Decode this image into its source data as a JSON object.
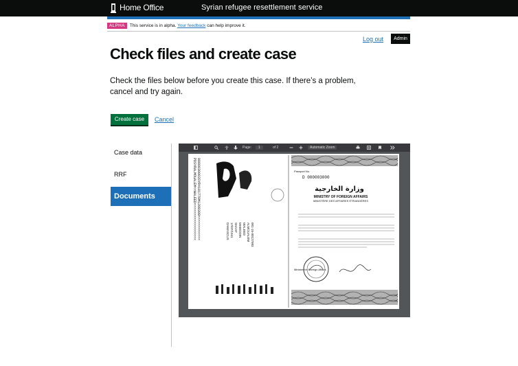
{
  "header": {
    "brand": "Home Office",
    "service_name": "Syrian refugee resettlement service"
  },
  "phase_banner": {
    "tag": "ALPHA",
    "text_before": "This service is in alpha.",
    "link": "Your feedback",
    "text_after": "can help improve it."
  },
  "account": {
    "logout": "Log out",
    "role_badge": "Admin"
  },
  "page": {
    "title": "Check files and create case",
    "lead": "Check the files below before you create this case. If there’s a problem, cancel and try again."
  },
  "actions": {
    "create": "Create case",
    "cancel": "Cancel"
  },
  "subnav": {
    "items": [
      "Case data",
      "RRF",
      "Documents"
    ],
    "active": "Documents"
  },
  "pdf_viewer": {
    "page_label": "Page:",
    "current_page": "1",
    "total_pages": "of 2",
    "zoom": "Automatic Zoom",
    "document": {
      "passport_label": "Passport No.",
      "passport_number": "D 000003000",
      "arabic_title": "وزارة الخارجية",
      "ministry_en": "MINISTRY OF FOREIGN AFFAIRS",
      "ministry_fr": "MINISTÈRE DES AFFAIRES ÉTRANGÈRES",
      "mrz_line1": "PDSYRALMOUALEM<<WALEED<<<<<<<<<<<<<<<<<<",
      "mrz_line2": "0000030003SYR4101770M1208308<<<<<<<<<<<<",
      "surname": "ALMOUALEM",
      "name": "WALEED",
      "father": "MHIEDDIN",
      "mother": "SHAAF",
      "dob": "17/07/1941",
      "place": "DAMASCUS",
      "id_no": "001-15-00127983",
      "signatory": "Minister for Foreign Affairs"
    }
  },
  "colors": {
    "header_bg": "#0b0c0c",
    "accent_blue": "#1d70b8",
    "alpha_tag": "#d53880",
    "button_green": "#00703c"
  }
}
